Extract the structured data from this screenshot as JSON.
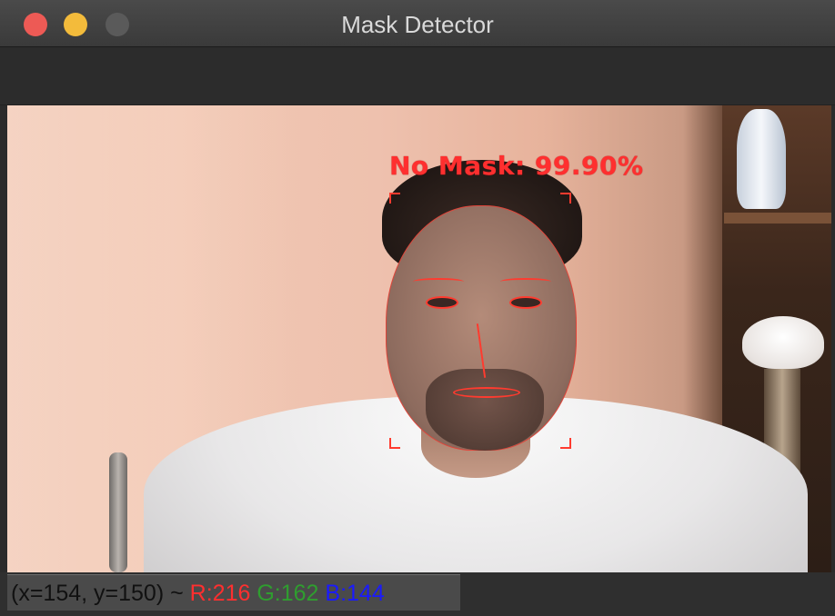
{
  "window": {
    "title": "Mask Detector"
  },
  "detection": {
    "label": "No Mask: 99.90%"
  },
  "status": {
    "coords": "(x=154, y=150)",
    "separator": " ~ ",
    "r": "R:216",
    "g": "G:162",
    "b": "B:144"
  },
  "colors": {
    "close": "#ed5a55",
    "minimize": "#f3bb3b",
    "maximize": "#5a5a5a",
    "detection": "#ff2f2f",
    "r": "#ff2f2f",
    "g": "#2f9e2f",
    "b": "#1a1aff"
  },
  "icons": {
    "close": "close-icon",
    "minimize": "minimize-icon",
    "maximize": "maximize-icon"
  }
}
